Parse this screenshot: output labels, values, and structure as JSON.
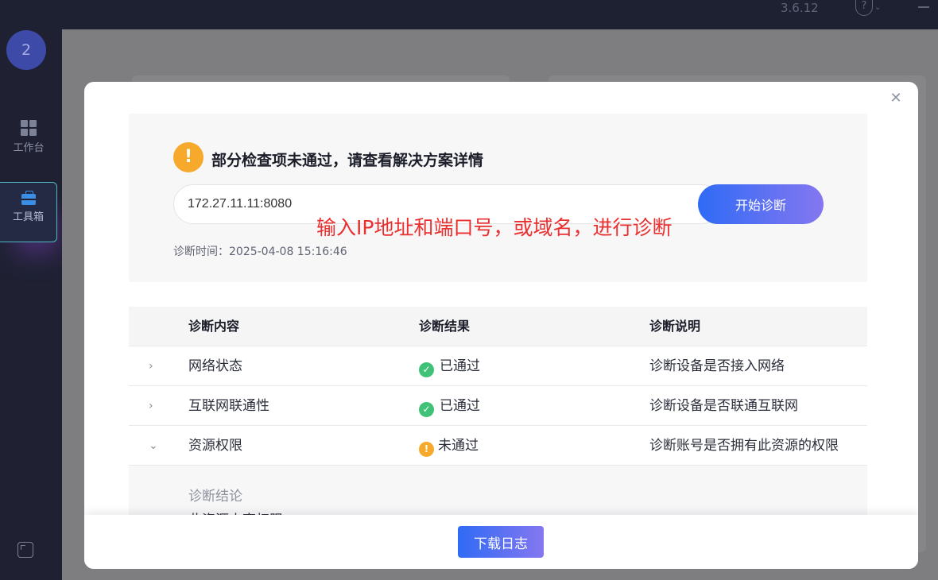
{
  "app": {
    "version": "3.6.12",
    "help_icon": "question-circle-icon"
  },
  "sidebar": {
    "badge": "2",
    "items": [
      {
        "label": "工作台",
        "icon": "grid-icon"
      },
      {
        "label": "工具箱",
        "icon": "toolbox-icon",
        "active": true
      }
    ],
    "bottom_icon": "export-icon"
  },
  "modal": {
    "status_icon": "warning-icon",
    "status_title": "部分检查项未通过，请查看解决方案详情",
    "ip_value": "172.27.11.11:8080",
    "start_button": "开始诊断",
    "hint": "输入IP地址和端口号，或域名，进行诊断",
    "diagnose_time": "诊断时间：2025-04-08 15:16:46",
    "table": {
      "headers": [
        "诊断内容",
        "诊断结果",
        "诊断说明"
      ],
      "rows": [
        {
          "name": "网络状态",
          "status": "已通过",
          "passed": true,
          "desc": "诊断设备是否接入网络",
          "expanded": false
        },
        {
          "name": "互联网联通性",
          "status": "已通过",
          "passed": true,
          "desc": "诊断设备是否联通互联网",
          "expanded": false
        },
        {
          "name": "资源权限",
          "status": "未通过",
          "passed": false,
          "desc": "诊断账号是否拥有此资源的权限",
          "expanded": true
        }
      ]
    },
    "conclusion_label": "诊断结论",
    "conclusion_text": "此资源未享权限",
    "download_button": "下载日志"
  },
  "colors": {
    "accent_start": "#2f6bf5",
    "accent_end": "#8577f0",
    "success": "#3fc277",
    "warning": "#f6a92a",
    "hint_red": "#ea2f2f"
  }
}
